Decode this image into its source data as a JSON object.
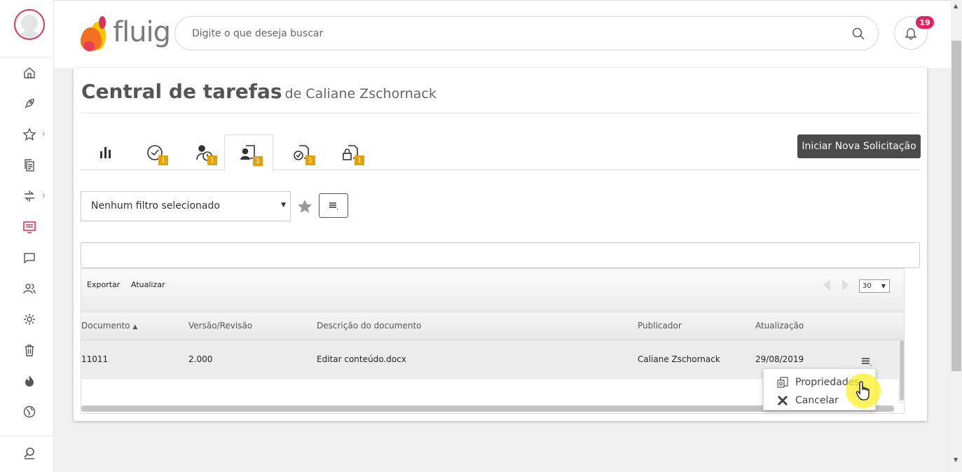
{
  "header": {
    "logo_text": "fluig",
    "search_placeholder": "Digite o que deseja buscar",
    "notification_count": "19"
  },
  "page": {
    "title": "Central de tarefas",
    "subtitle": "de Caliane Zschornack"
  },
  "tabs": [
    {
      "icon": "bar-chart-icon",
      "badge": ""
    },
    {
      "icon": "clock-check-icon",
      "badge": "1"
    },
    {
      "icon": "user-clock-icon",
      "badge": "1"
    },
    {
      "icon": "user-document-icon",
      "badge": "1",
      "active": true
    },
    {
      "icon": "document-clock-icon",
      "badge": "1"
    },
    {
      "icon": "document-lock-icon",
      "badge": "1"
    }
  ],
  "actions": {
    "new_request_label": "Iniciar Nova Solicitação"
  },
  "filter": {
    "selected": "Nenhum filtro selecionado"
  },
  "grid": {
    "toolbar": {
      "export_label": "Exportar",
      "refresh_label": "Atualizar",
      "page_size": "30"
    },
    "columns": [
      "Documento",
      "Versão/Revisão",
      "Descrição do documento",
      "Publicador",
      "Atualização"
    ],
    "rows": [
      {
        "documento": "11011",
        "versao": "2.000",
        "descricao": "Editar conteúdo.docx",
        "publicador": "Caliane Zschornack",
        "atualizacao": "29/08/2019"
      }
    ]
  },
  "context_menu": {
    "properties_label": "Propriedades",
    "cancel_label": "Cancelar"
  },
  "colors": {
    "accent": "#d6365c",
    "badge": "#e2a20b",
    "notification": "#e0245e",
    "button_dark": "#4b4b4b"
  }
}
